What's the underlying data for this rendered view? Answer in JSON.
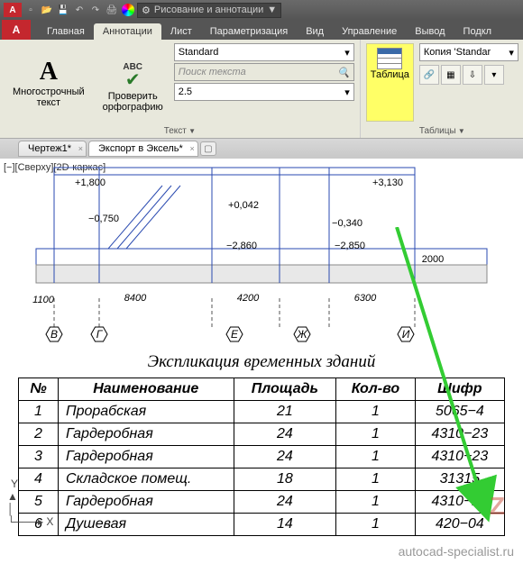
{
  "titlebar": {
    "logo": "A",
    "workspace": "Рисование и аннотации"
  },
  "ribbon_tabs": {
    "logo": "A",
    "items": [
      "Главная",
      "Аннотации",
      "Лист",
      "Параметризация",
      "Вид",
      "Управление",
      "Вывод",
      "Подкл"
    ],
    "active_index": 1
  },
  "panels": {
    "text": {
      "title": "Текст",
      "mtext_btn": "Многострочный\nтекст",
      "check_btn": "Проверить\nорфографию",
      "abc_lbl": "ABC",
      "style_dd": "Standard",
      "search_placeholder": "Поиск текста",
      "height_dd": "2.5"
    },
    "table": {
      "btn": "Таблица",
      "title": "Таблицы",
      "style_dd": "Копия 'Standar"
    }
  },
  "doc_tabs": {
    "items": [
      "Чертеж1*",
      "Экспорт в Эксель*"
    ],
    "active_index": 1
  },
  "view_label": "[−][Сверху][2D-каркас]",
  "drawing_dims": {
    "d1": "+1,800",
    "d2": "−0,750",
    "d3": "+0,042",
    "d4": "+3,130",
    "d5": "−2,860",
    "d6": "−0,340",
    "d7": "−2,850",
    "d8": "2000",
    "w0": "1100",
    "w1": "8400",
    "w2": "4200",
    "w3": "6300",
    "a1": "В",
    "a2": "Г",
    "a3": "Е",
    "a4": "Ж",
    "a5": "И"
  },
  "table": {
    "title": "Экспликация временных зданий",
    "headers": [
      "№",
      "Наименование",
      "Площадь",
      "Кол-во",
      "Шифр"
    ],
    "rows": [
      {
        "n": "1",
        "name": "Прорабская",
        "area": "21",
        "qty": "1",
        "code": "5065−4"
      },
      {
        "n": "2",
        "name": "Гардеробная",
        "area": "24",
        "qty": "1",
        "code": "4310−23"
      },
      {
        "n": "3",
        "name": "Гардеробная",
        "area": "24",
        "qty": "1",
        "code": "4310−23"
      },
      {
        "n": "4",
        "name": "Складское помещ.",
        "area": "18",
        "qty": "1",
        "code": "31315"
      },
      {
        "n": "5",
        "name": "Гардеробная",
        "area": "24",
        "qty": "1",
        "code": "4310−23"
      },
      {
        "n": "6",
        "name": "Душевая",
        "area": "14",
        "qty": "1",
        "code": "420−04"
      }
    ]
  },
  "watermark": "autocad-specialist.ru",
  "ucs": {
    "y": "Y",
    "x": "X"
  }
}
